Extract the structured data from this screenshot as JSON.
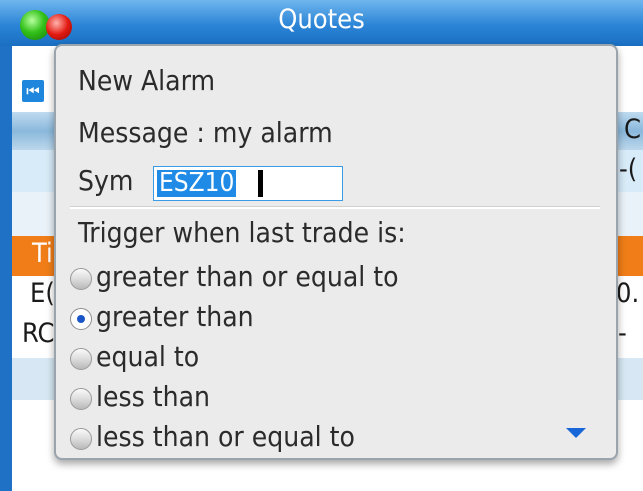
{
  "window": {
    "title": "Quotes"
  },
  "background": {
    "row_text": {
      "right_header": "C",
      "right_value1": "-(",
      "orange_left": "Ti",
      "data1_left": "E(",
      "data1_right": "0.",
      "data2_left": "RC",
      "data2_right": "-"
    }
  },
  "dialog": {
    "title": "New Alarm",
    "message_line": "Message : my alarm",
    "sym_label": "Sym",
    "sym_value": "ESZ10",
    "trigger_label": "Trigger when last trade is:",
    "options": [
      {
        "label": "greater than or equal to",
        "selected": false
      },
      {
        "label": "greater than",
        "selected": true
      },
      {
        "label": "equal to",
        "selected": false
      },
      {
        "label": "less than",
        "selected": false
      },
      {
        "label": "less than or equal to",
        "selected": false
      }
    ]
  },
  "colors": {
    "accent": "#1f71c6",
    "header_orange": "#f07d18",
    "selection": "#1f8be6"
  }
}
